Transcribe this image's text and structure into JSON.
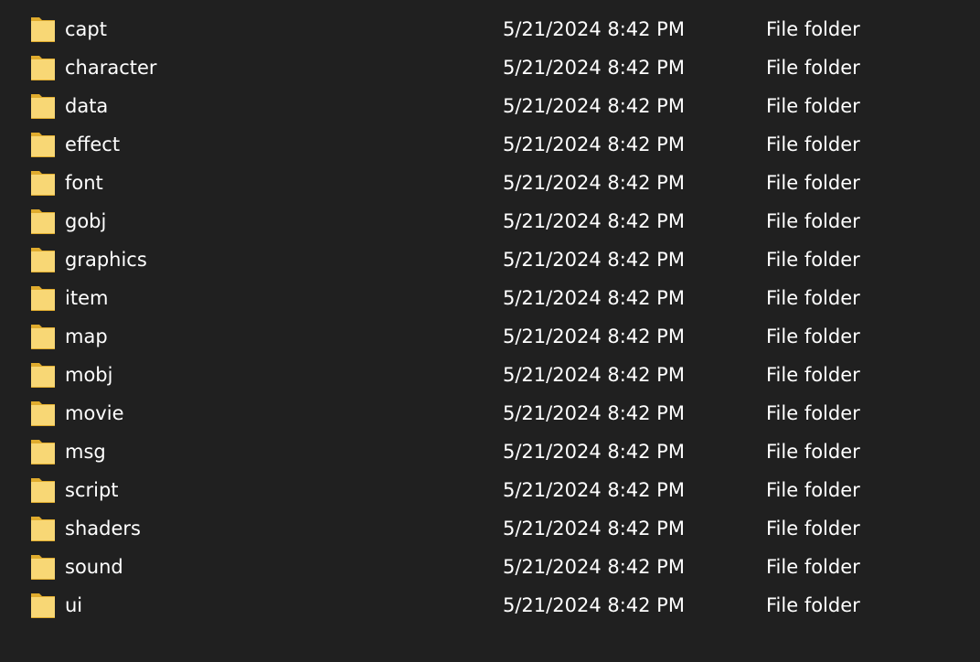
{
  "colors": {
    "background": "#202020",
    "text": "#ffffff",
    "folder_fill": "#f8d775",
    "folder_edge": "#e0ac2e"
  },
  "icons": {
    "folder": "folder-icon"
  },
  "files": [
    {
      "name": "capt",
      "date_modified": "5/21/2024 8:42 PM",
      "type": "File folder"
    },
    {
      "name": "character",
      "date_modified": "5/21/2024 8:42 PM",
      "type": "File folder"
    },
    {
      "name": "data",
      "date_modified": "5/21/2024 8:42 PM",
      "type": "File folder"
    },
    {
      "name": "effect",
      "date_modified": "5/21/2024 8:42 PM",
      "type": "File folder"
    },
    {
      "name": "font",
      "date_modified": "5/21/2024 8:42 PM",
      "type": "File folder"
    },
    {
      "name": "gobj",
      "date_modified": "5/21/2024 8:42 PM",
      "type": "File folder"
    },
    {
      "name": "graphics",
      "date_modified": "5/21/2024 8:42 PM",
      "type": "File folder"
    },
    {
      "name": "item",
      "date_modified": "5/21/2024 8:42 PM",
      "type": "File folder"
    },
    {
      "name": "map",
      "date_modified": "5/21/2024 8:42 PM",
      "type": "File folder"
    },
    {
      "name": "mobj",
      "date_modified": "5/21/2024 8:42 PM",
      "type": "File folder"
    },
    {
      "name": "movie",
      "date_modified": "5/21/2024 8:42 PM",
      "type": "File folder"
    },
    {
      "name": "msg",
      "date_modified": "5/21/2024 8:42 PM",
      "type": "File folder"
    },
    {
      "name": "script",
      "date_modified": "5/21/2024 8:42 PM",
      "type": "File folder"
    },
    {
      "name": "shaders",
      "date_modified": "5/21/2024 8:42 PM",
      "type": "File folder"
    },
    {
      "name": "sound",
      "date_modified": "5/21/2024 8:42 PM",
      "type": "File folder"
    },
    {
      "name": "ui",
      "date_modified": "5/21/2024 8:42 PM",
      "type": "File folder"
    }
  ]
}
